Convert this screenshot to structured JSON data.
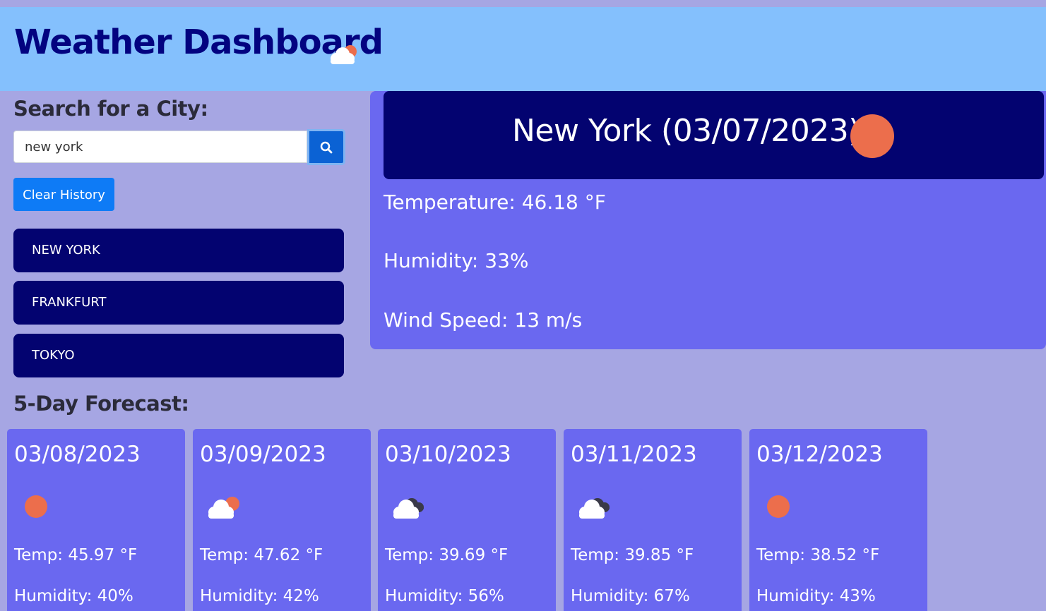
{
  "colors": {
    "background": "#a6a6e3",
    "header_bg": "#84c0fd",
    "title_color": "#030380",
    "dark_navy": "#030370",
    "card_bg": "#6a68f0",
    "primary_button": "#0e7bf6",
    "search_button": "#0b62d4",
    "sun": "#ec6e4c"
  },
  "header": {
    "title": "Weather Dashboard",
    "icon": "cloud-with-sun-icon"
  },
  "search": {
    "label": "Search for a City:",
    "value": "new york",
    "button_icon": "search-icon"
  },
  "clear_history": {
    "label": "Clear History"
  },
  "history": [
    {
      "label": "NEW YORK"
    },
    {
      "label": "FRANKFURT"
    },
    {
      "label": "TOKYO"
    }
  ],
  "current": {
    "title": "New York (03/07/2023)",
    "icon": "sun-icon",
    "temperature": "Temperature: 46.18 °F",
    "humidity": "Humidity: 33%",
    "wind": "Wind Speed: 13 m/s"
  },
  "forecast": {
    "label": "5-Day Forecast:",
    "days": [
      {
        "date": "03/08/2023",
        "icon": "sun-icon",
        "temp": "Temp: 45.97 °F",
        "humidity": "Humidity: 40%"
      },
      {
        "date": "03/09/2023",
        "icon": "cloud-with-sun-icon",
        "temp": "Temp: 47.62 °F",
        "humidity": "Humidity: 42%"
      },
      {
        "date": "03/10/2023",
        "icon": "cloudy-icon",
        "temp": "Temp: 39.69 °F",
        "humidity": "Humidity: 56%"
      },
      {
        "date": "03/11/2023",
        "icon": "cloudy-icon",
        "temp": "Temp: 39.85 °F",
        "humidity": "Humidity: 67%"
      },
      {
        "date": "03/12/2023",
        "icon": "sun-icon",
        "temp": "Temp: 38.52 °F",
        "humidity": "Humidity: 43%"
      }
    ]
  }
}
